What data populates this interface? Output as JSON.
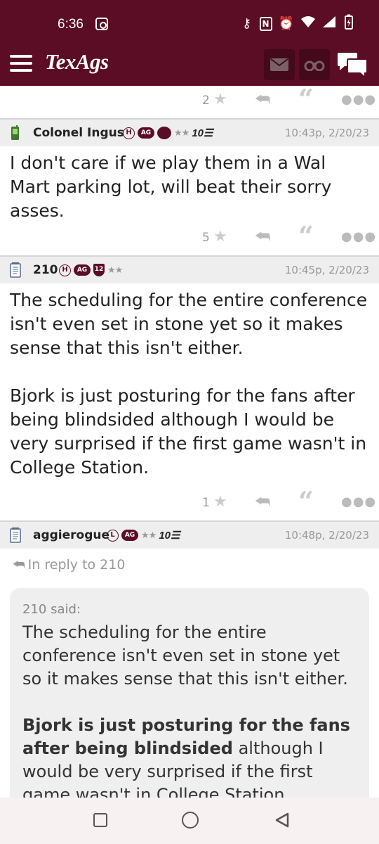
{
  "status_bar": {
    "time": "6:36",
    "icons": [
      "cast-icon",
      "key-icon",
      "nfc-icon",
      "alarm-icon",
      "wifi-icon",
      "signal-icon",
      "battery-icon"
    ]
  },
  "app_bar": {
    "logo": "TexAgs",
    "colors": {
      "maroon": "#5b0d26",
      "maroon_dark": "#44091b"
    }
  },
  "top_actions": {
    "count": "2"
  },
  "posts": [
    {
      "username": "Colonel Ingus",
      "timestamp": "10:43p, 2/20/23",
      "badge_rank": "H",
      "badge_ag": "AG",
      "badge_stars": "★★",
      "badge_ten": "10☰",
      "body": [
        "I don't care if we play them in a Wal Mart parking lot, will beat their sorry asses."
      ],
      "count": "5"
    },
    {
      "username": "210",
      "timestamp": "10:45p, 2/20/23",
      "badge_rank": "H",
      "badge_ag": "AG",
      "badge_shield": "12",
      "badge_stars": "★★",
      "body": [
        "The scheduling for the entire conference isn't even set in stone yet so it makes sense that this isn't either.",
        "Bjork is just posturing for the fans after being blindsided although I would be very surprised if the first game wasn't in College Station."
      ],
      "count": "1"
    },
    {
      "username": "aggierogue",
      "timestamp": "10:48p, 2/20/23",
      "badge_rank": "L",
      "badge_ag": "AG",
      "badge_stars": "★★",
      "badge_ten": "10☰",
      "in_reply_to": "In reply to 210",
      "quote": {
        "said": "210 said:",
        "para1": "The scheduling for the entire conference isn't even set in stone yet so it makes sense that this isn't either.",
        "para2_bold": "Bjork is just posturing for the fans after being blindsided",
        "para2_rest": " although I would be very surprised if the first game wasn't in College Station."
      }
    }
  ]
}
